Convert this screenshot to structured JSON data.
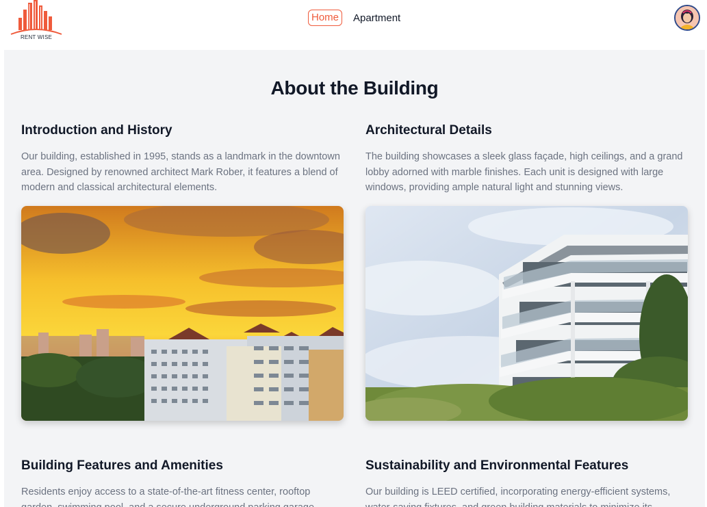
{
  "navbar": {
    "logo_text": "RENT WISE",
    "links": [
      {
        "label": "Home",
        "active": true
      },
      {
        "label": "Apartment",
        "active": false
      }
    ],
    "accent_color": "#ef5b3c"
  },
  "page": {
    "title": "About the Building",
    "sections": [
      {
        "heading": "Introduction and History",
        "text": "Our building, established in 1995, stands as a landmark in the downtown area. Designed by renowned architect Mark Rober, it features a blend of modern and classical architectural elements."
      },
      {
        "heading": "Architectural Details",
        "text": "The building showcases a sleek glass façade, high ceilings, and a grand lobby adorned with marble finishes. Each unit is designed with large windows, providing ample natural light and stunning views."
      },
      {
        "heading": "Building Features and Amenities",
        "text": "Residents enjoy access to a state-of-the-art fitness center, rooftop garden, swimming pool, and a secure underground parking garage. Where they"
      },
      {
        "heading": "Sustainability and Environmental Features",
        "text": "Our building is LEED certified, incorporating energy-efficient systems, water-saving fixtures, and green building materials to minimize its"
      }
    ],
    "images": [
      {
        "icon": "sunset-cityscape-image"
      },
      {
        "icon": "white-apartment-building-image"
      }
    ]
  }
}
